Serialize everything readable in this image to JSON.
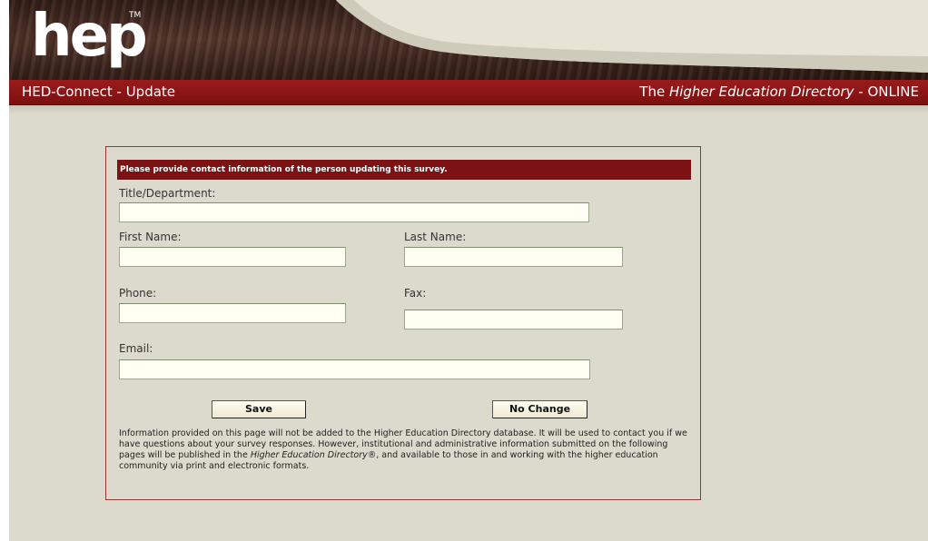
{
  "header": {
    "logo_text": "hep",
    "logo_mark": "TM",
    "app_title": "HED-Connect - Update",
    "tagline_prefix": "The ",
    "tagline_italic": "Higher Education Directory",
    "tagline_suffix": " - ONLINE"
  },
  "form": {
    "banner": "Please provide contact information of the person updating this survey.",
    "fields": {
      "title_department": {
        "label": "Title/Department:",
        "value": ""
      },
      "first_name": {
        "label": "First Name:",
        "value": ""
      },
      "last_name": {
        "label": "Last Name:",
        "value": ""
      },
      "phone": {
        "label": "Phone:",
        "value": ""
      },
      "fax": {
        "label": "Fax:",
        "value": ""
      },
      "email": {
        "label": "Email:",
        "value": ""
      }
    },
    "buttons": {
      "save": "Save",
      "no_change": "No Change"
    },
    "note": {
      "part1": "Information provided on this page will not be added to the Higher Education Directory database. It will be used to contact you if we have questions about your survey responses. However, institutional and administrative information submitted on the following pages will be published in the ",
      "italic": "Higher Education Directory",
      "part2": "®, and available to those in and working with the higher education community via print and electronic formats."
    }
  },
  "colors": {
    "brand_red": "#7d1214",
    "background": "#dcd9cd",
    "header_wood": "#3b241d",
    "card_border": "#9c3333"
  }
}
